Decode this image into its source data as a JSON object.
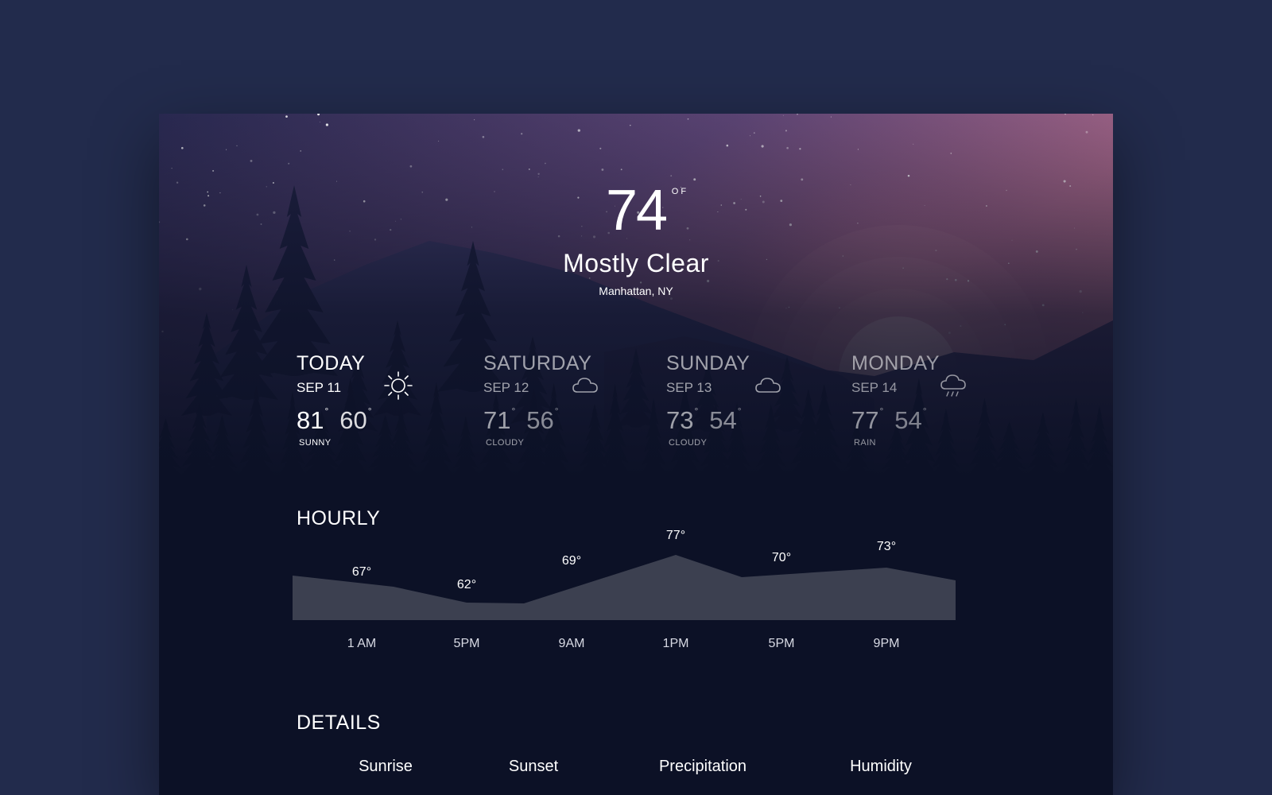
{
  "current": {
    "temperature": "74",
    "unit": "OF",
    "condition": "Mostly Clear",
    "location": "Manhattan, NY"
  },
  "forecast": [
    {
      "day": "TODAY",
      "date": "SEP 11",
      "high": "81",
      "low": "60",
      "desc": "SUNNY",
      "icon": "sun-icon"
    },
    {
      "day": "SATURDAY",
      "date": "SEP 12",
      "high": "71",
      "low": "56",
      "desc": "CLOUDY",
      "icon": "cloud-icon"
    },
    {
      "day": "SUNDAY",
      "date": "SEP 13",
      "high": "73",
      "low": "54",
      "desc": "CLOUDY",
      "icon": "cloud-icon"
    },
    {
      "day": "MONDAY",
      "date": "SEP 14",
      "high": "77",
      "low": "54",
      "desc": "RAIN",
      "icon": "rain-cloud-icon"
    }
  ],
  "hourly": {
    "title": "HOURLY",
    "chart_data": {
      "type": "area",
      "categories": [
        "1 AM",
        "5PM",
        "9AM",
        "1PM",
        "5PM",
        "9PM"
      ],
      "values": [
        67,
        62,
        69,
        77,
        70,
        73
      ],
      "value_labels": [
        "67°",
        "62°",
        "69°",
        "77°",
        "70°",
        "73°"
      ],
      "fill_color": "#3c4050"
    }
  },
  "details": {
    "title": "DETAILS",
    "labels": [
      "Sunrise",
      "Sunset",
      "Precipitation",
      "Humidity"
    ]
  },
  "colors": {
    "page_background": "#222b4c",
    "card_background": "#0c1126",
    "sky_top": "#2e2c55",
    "sky_glow": "#c97f98",
    "chart_fill": "#3c4050"
  }
}
